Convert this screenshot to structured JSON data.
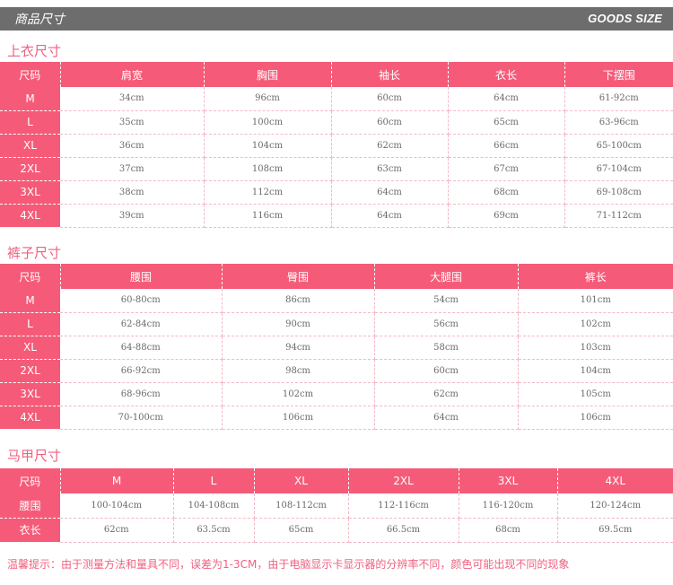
{
  "header": {
    "title_cn": "商品尺寸",
    "title_en": "GOODS SIZE"
  },
  "tops": {
    "title": "上衣尺寸",
    "columns": [
      "尺码",
      "肩宽",
      "胸围",
      "袖长",
      "衣长",
      "下摆围"
    ],
    "rows": [
      [
        "M",
        "34cm",
        "96cm",
        "60cm",
        "64cm",
        "61-92cm"
      ],
      [
        "L",
        "35cm",
        "100cm",
        "60cm",
        "65cm",
        "63-96cm"
      ],
      [
        "XL",
        "36cm",
        "104cm",
        "62cm",
        "66cm",
        "65-100cm"
      ],
      [
        "2XL",
        "37cm",
        "108cm",
        "63cm",
        "67cm",
        "67-104cm"
      ],
      [
        "3XL",
        "38cm",
        "112cm",
        "64cm",
        "68cm",
        "69-108cm"
      ],
      [
        "4XL",
        "39cm",
        "116cm",
        "64cm",
        "69cm",
        "71-112cm"
      ]
    ]
  },
  "pants": {
    "title": "裤子尺寸",
    "columns": [
      "尺码",
      "腰围",
      "臀围",
      "大腿围",
      "裤长"
    ],
    "rows": [
      [
        "M",
        "60-80cm",
        "86cm",
        "54cm",
        "101cm"
      ],
      [
        "L",
        "62-84cm",
        "90cm",
        "56cm",
        "102cm"
      ],
      [
        "XL",
        "64-88cm",
        "94cm",
        "58cm",
        "103cm"
      ],
      [
        "2XL",
        "66-92cm",
        "98cm",
        "60cm",
        "104cm"
      ],
      [
        "3XL",
        "68-96cm",
        "102cm",
        "62cm",
        "105cm"
      ],
      [
        "4XL",
        "70-100cm",
        "106cm",
        "64cm",
        "106cm"
      ]
    ]
  },
  "vest": {
    "title": "马甲尺寸",
    "columns": [
      "尺码",
      "M",
      "L",
      "XL",
      "2XL",
      "3XL",
      "4XL"
    ],
    "rows": [
      [
        "腰围",
        "100-104cm",
        "104-108cm",
        "108-112cm",
        "112-116cm",
        "116-120cm",
        "120-124cm"
      ],
      [
        "衣长",
        "62cm",
        "63.5cm",
        "65cm",
        "66.5cm",
        "68cm",
        "69.5cm"
      ]
    ]
  },
  "note": "温馨提示：由于测量方法和量具不同，误差为1-3CM，由于电脑显示卡显示器的分辨率不同，颜色可能出现不同的现象"
}
